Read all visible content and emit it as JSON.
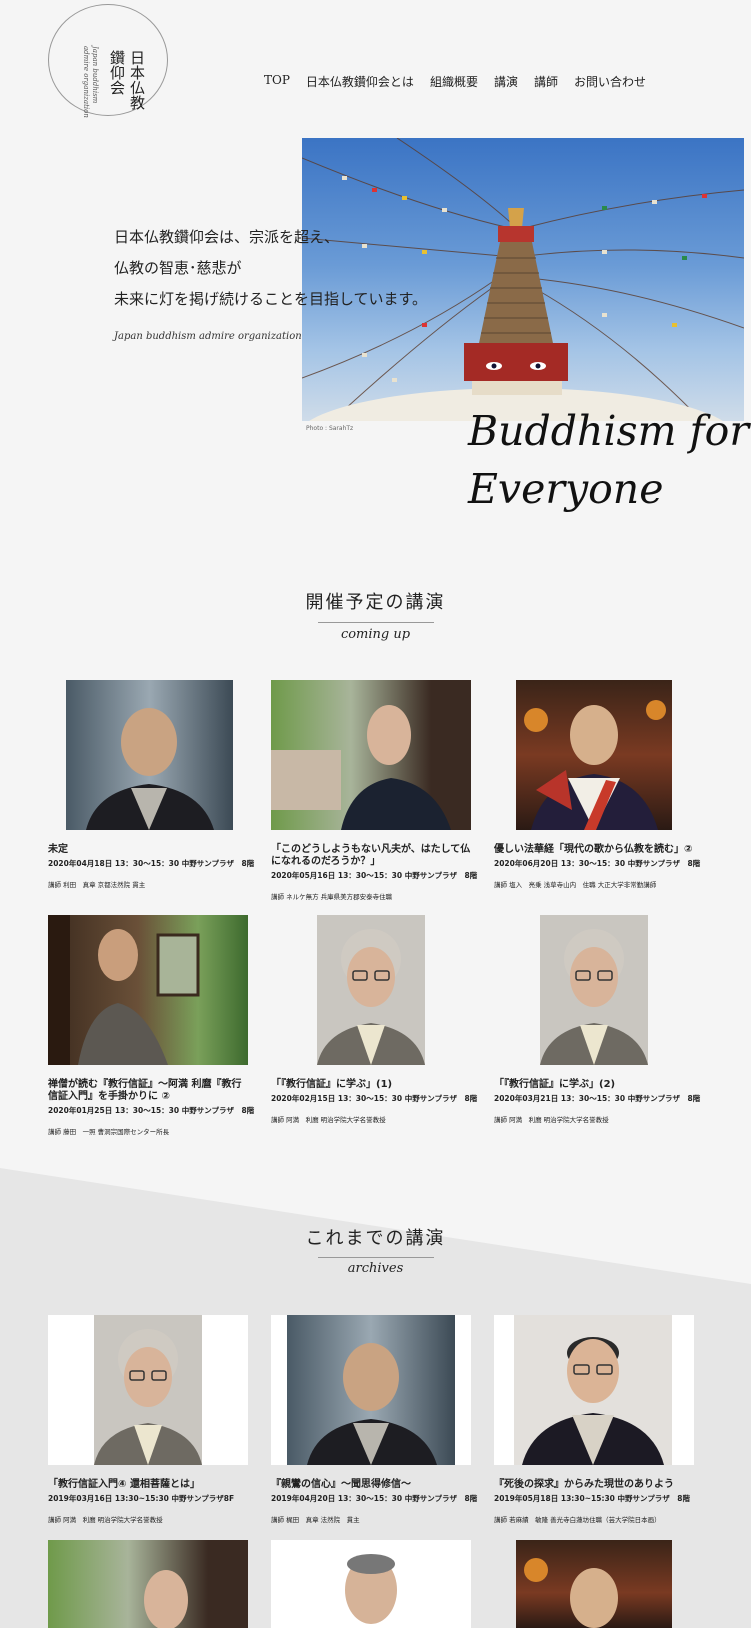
{
  "logo": {
    "name_jp_col1": "日本仏教",
    "name_jp_col2": "鑽仰会",
    "name_en_col1": "Japan buddhism",
    "name_en_col2": "admire organization"
  },
  "nav": {
    "items": [
      "TOP",
      "日本仏教鑽仰会とは",
      "組織概要",
      "講演",
      "講師",
      "お問い合わせ"
    ]
  },
  "hero": {
    "lines": [
      "日本仏教鑽仰会は、宗派を超え、",
      "仏教の智恵･慈悲が",
      "未来に灯を掲げ続けることを目指しています。"
    ],
    "subtitle": "Japan buddhism admire organization",
    "photo_credit": "Photo : SarahTz",
    "tagline_line1": "Buddhism for",
    "tagline_line2": "Everyone"
  },
  "upcoming": {
    "title": "開催予定の講演",
    "subtitle": "coming up",
    "cards": [
      {
        "title": "未定",
        "date": "2020年04月18日 13：30～15：30 中野サンプラザ　8階",
        "speaker": "講師 利田　真章 京都法然院 貫主"
      },
      {
        "title": "「このどうしようもない凡夫が、はたして仏になれるのだろうか？」",
        "date": "2020年05月16日 13：30～15：30 中野サンプラザ　8階",
        "speaker": "講師 ネルケ無方 兵庫県美方郡安泰寺住職"
      },
      {
        "title": "優しい法華経「現代の歌から仏教を読む」②",
        "date": "2020年06月20日 13：30～15：30 中野サンプラザ　8階",
        "speaker": "講師 塩入　亮乗 浅草寺山内　住職 大正大学非常勤講師"
      },
      {
        "title": "禅僧が読む『教行信証』～阿満 利麿『教行信証入門』を手掛かりに ②",
        "date": "2020年01月25日 13：30～15：30 中野サンプラザ　8階",
        "speaker": "講師 藤田　一照 曹洞宗国際センター所長"
      },
      {
        "title": "「『教行信証』に学ぶ」(1)",
        "date": "2020年02月15日 13：30～15：30 中野サンプラザ　8階",
        "speaker": "講師 阿満　利麿 明治学院大学名誉教授"
      },
      {
        "title": "「『教行信証』に学ぶ」(2)",
        "date": "2020年03月21日 13：30～15：30 中野サンプラザ　8階",
        "speaker": "講師 阿満　利麿 明治学院大学名誉教授"
      }
    ]
  },
  "archives": {
    "title": "これまでの講演",
    "subtitle": "archives",
    "cards": [
      {
        "title": "「教行信証入門④ 還相菩薩とは」",
        "date": "2019年03月16日 13:30~15:30 中野サンプラザ8F",
        "speaker": "講師 阿満　利麿 明治学院大学名誉教授"
      },
      {
        "title": "『親鸞の信心』～聞思得修信～",
        "date": "2019年04月20日 13：30～15：30 中野サンプラザ　8階",
        "speaker": "講師 梶田　真章 法然院　貫主"
      },
      {
        "title": "『死後の探求』からみた現世のありよう",
        "date": "2019年05月18日 13:30~15:30 中野サンプラザ　8階",
        "speaker": "講師 若麻績　敏隆 善光寺白蓮坊住職（芸大学院日本画）"
      }
    ]
  }
}
